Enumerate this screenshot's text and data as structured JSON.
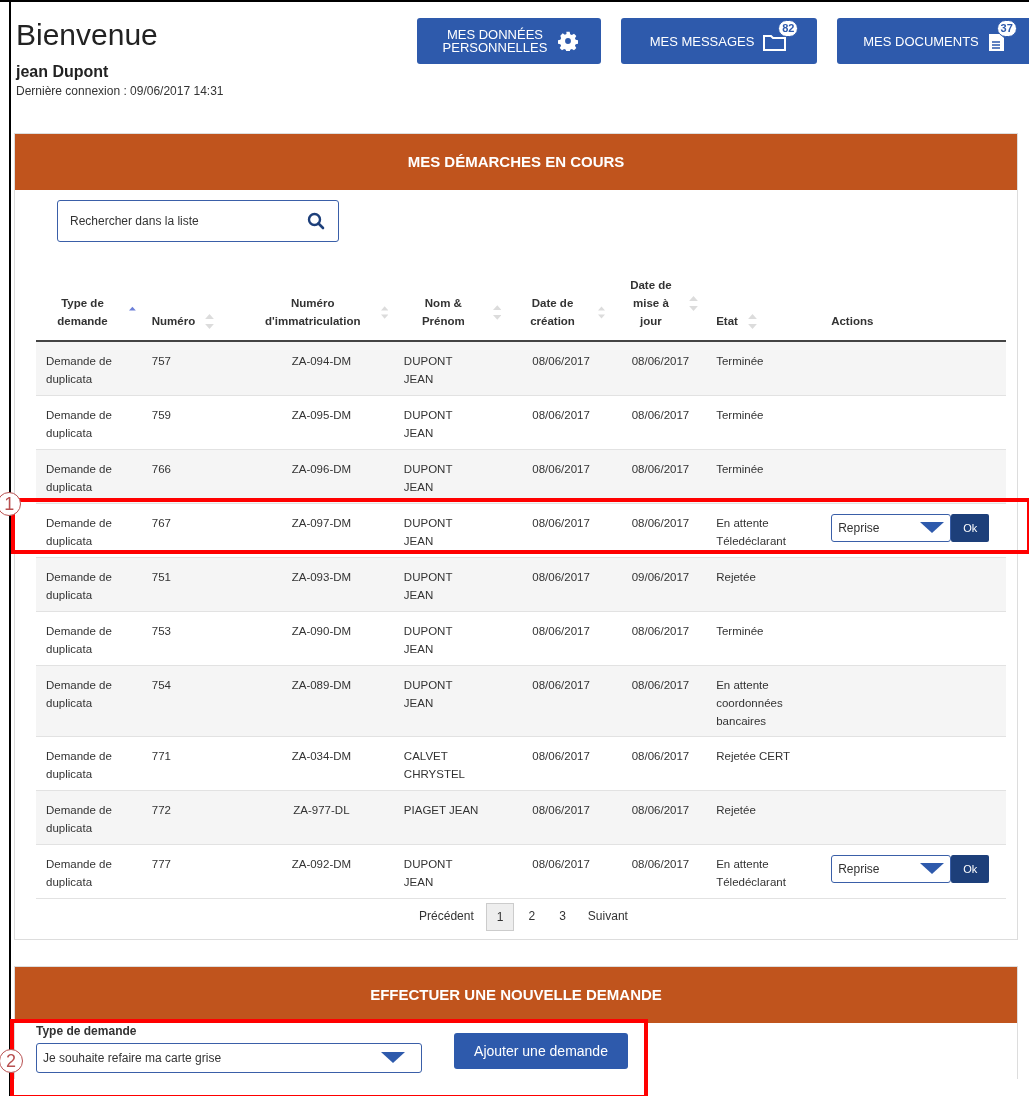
{
  "header": {
    "title": "Bienvenue",
    "user": "jean Dupont",
    "last_login": "Dernière connexion : 09/06/2017 14:31",
    "buttons": [
      {
        "kind": "gear",
        "label": "MES DONNÉES PERSONNELLES"
      },
      {
        "kind": "messages",
        "label": "MES MESSAGES",
        "badge": "82"
      },
      {
        "kind": "documents",
        "label": "MES DOCUMENTS",
        "badge": "37"
      }
    ]
  },
  "current": {
    "title": "MES DÉMARCHES EN COURS",
    "search": {
      "placeholder": "Rechercher dans la liste"
    },
    "columns": [
      {
        "label": "Type de demande",
        "sorted": true
      },
      {
        "label": "Numéro",
        "sorted": false
      },
      {
        "label": "Numéro d'immatriculation",
        "sorted": false
      },
      {
        "label": "Nom & Prénom",
        "sorted": false
      },
      {
        "label": "Date de création",
        "sorted": false
      },
      {
        "label": "Date de mise à jour",
        "sorted": false
      },
      {
        "label": "Etat",
        "sorted": false
      },
      {
        "label": "Actions"
      }
    ],
    "rows": [
      {
        "cells": [
          "Demande de duplicata",
          "757",
          "ZA-094-DM",
          "DUPONT JEAN",
          "08/06/2017",
          "08/06/2017",
          "Terminée"
        ]
      },
      {
        "cells": [
          "Demande de duplicata",
          "759",
          "ZA-095-DM",
          "DUPONT JEAN",
          "08/06/2017",
          "08/06/2017",
          "Terminée"
        ]
      },
      {
        "cells": [
          "Demande de duplicata",
          "766",
          "ZA-096-DM",
          "DUPONT JEAN",
          "08/06/2017",
          "08/06/2017",
          "Terminée"
        ]
      },
      {
        "cells": [
          "Demande de duplicata",
          "767",
          "ZA-097-DM",
          "DUPONT JEAN",
          "08/06/2017",
          "08/06/2017",
          "En attente Téledéclarant"
        ],
        "action": {
          "value": "Reprise",
          "button": "Ok"
        },
        "callout": "1"
      },
      {
        "cells": [
          "Demande de duplicata",
          "751",
          "ZA-093-DM",
          "DUPONT JEAN",
          "08/06/2017",
          "09/06/2017",
          "Rejetée"
        ]
      },
      {
        "cells": [
          "Demande de duplicata",
          "753",
          "ZA-090-DM",
          "DUPONT JEAN",
          "08/06/2017",
          "08/06/2017",
          "Terminée"
        ]
      },
      {
        "cells": [
          "Demande de duplicata",
          "754",
          "ZA-089-DM",
          "DUPONT JEAN",
          "08/06/2017",
          "08/06/2017",
          "En attente coordonnées bancaires"
        ]
      },
      {
        "cells": [
          "Demande de duplicata",
          "771",
          "ZA-034-DM",
          "CALVET CHRYSTEL",
          "08/06/2017",
          "08/06/2017",
          "Rejetée CERT"
        ]
      },
      {
        "cells": [
          "Demande de duplicata",
          "772",
          "ZA-977-DL",
          "PIAGET JEAN",
          "08/06/2017",
          "08/06/2017",
          "Rejetée"
        ]
      },
      {
        "cells": [
          "Demande de duplicata",
          "777",
          "ZA-092-DM",
          "DUPONT JEAN",
          "08/06/2017",
          "08/06/2017",
          "En attente Téledéclarant"
        ],
        "action": {
          "value": "Reprise",
          "button": "Ok"
        }
      }
    ],
    "pagination": {
      "previous": "Précédent",
      "pages": [
        {
          "label": "1",
          "selected": true
        },
        {
          "label": "2",
          "selected": false
        },
        {
          "label": "3",
          "selected": false
        }
      ],
      "next": "Suivant"
    }
  },
  "new_request": {
    "title": "EFFECTUER UNE NOUVELLE DEMANDE",
    "field_label": "Type de demande",
    "select_value": "Je souhaite refaire ma carte grise",
    "button": "Ajouter une demande",
    "callout": "2"
  }
}
